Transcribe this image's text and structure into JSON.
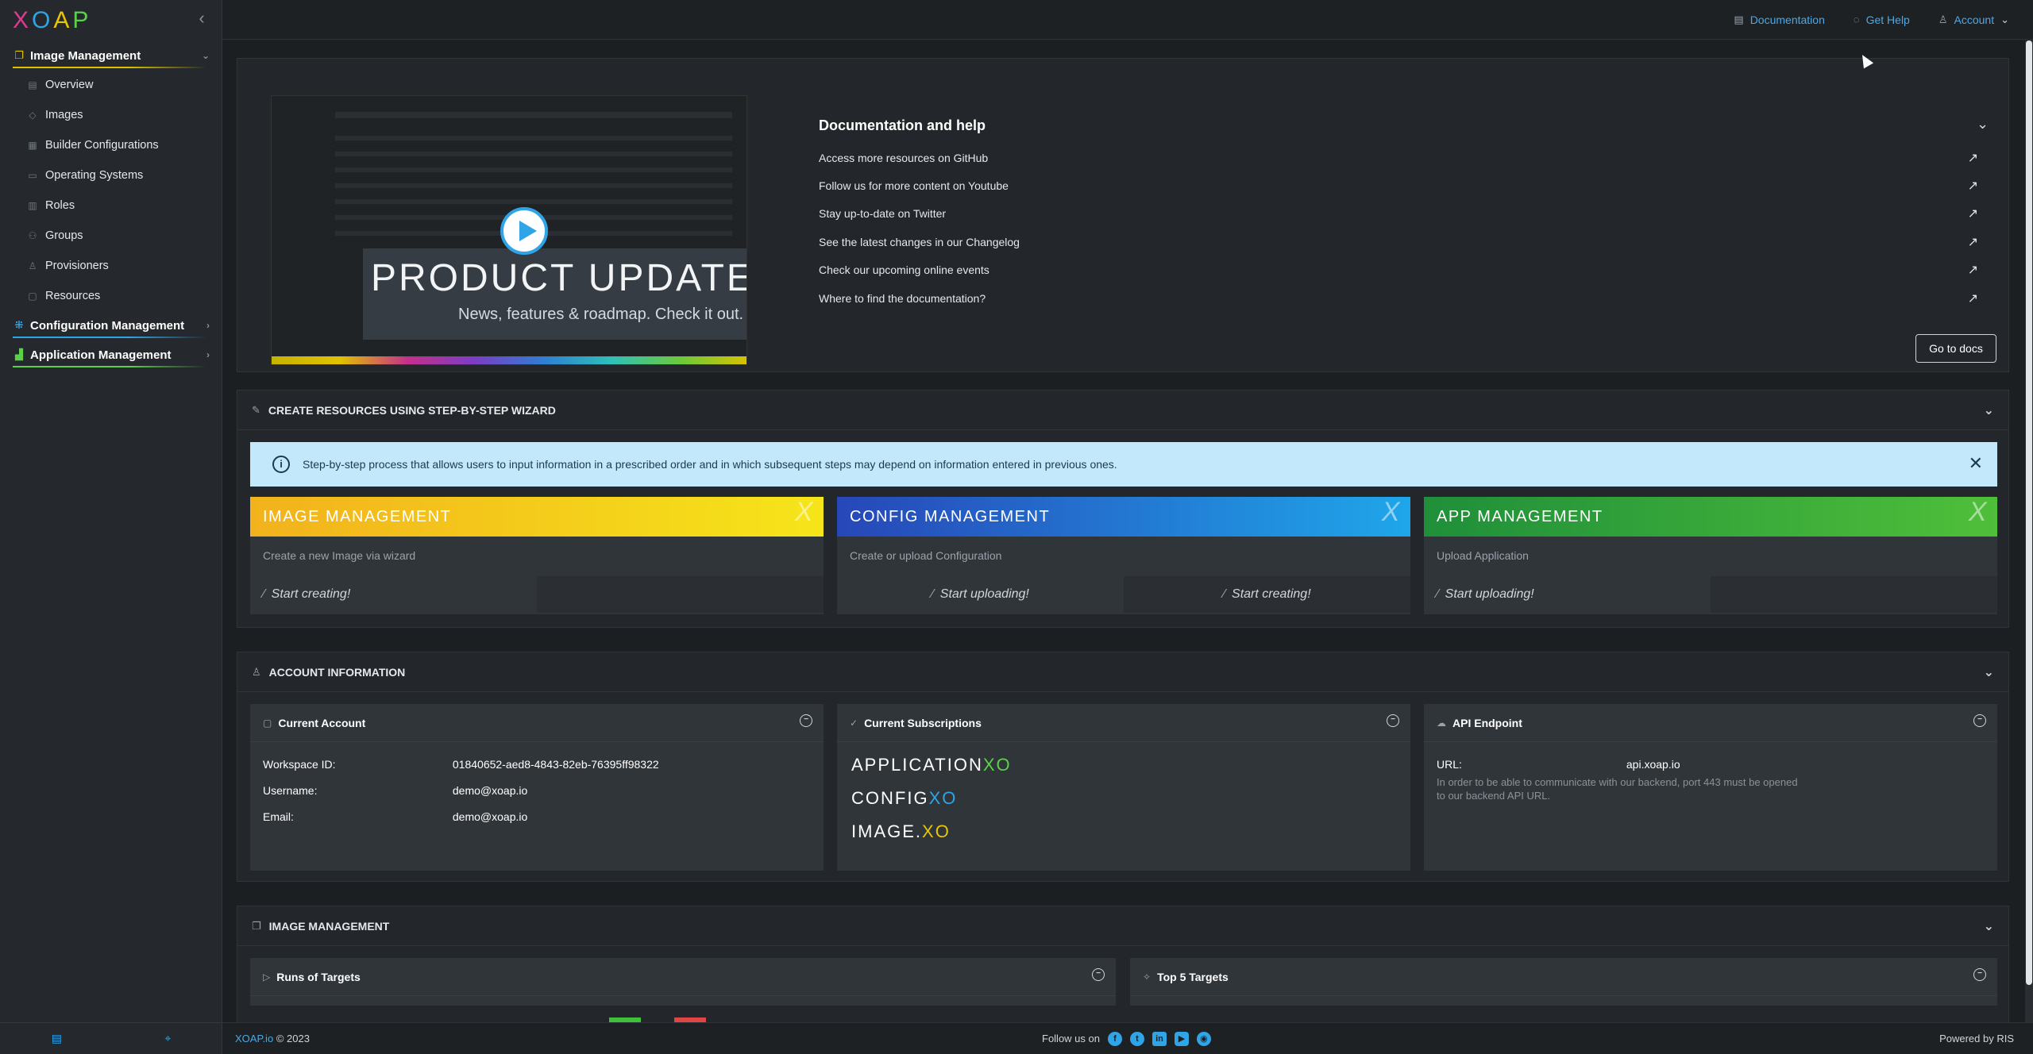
{
  "app": {
    "logo_letters": [
      "X",
      "O",
      "A",
      "P"
    ],
    "logo_colors": [
      "#e03a8e",
      "#2fa4e7",
      "#e8c600",
      "#5bd14a"
    ]
  },
  "sidebar": {
    "groups": [
      {
        "label": "Image Management",
        "icon": "image-stack-icon",
        "expanded": true,
        "underline": "#d9c200"
      },
      {
        "label": "Configuration Management",
        "icon": "config-grid-icon",
        "expanded": false,
        "underline": "#2fa4e7"
      },
      {
        "label": "Application Management",
        "icon": "app-bars-icon",
        "expanded": false,
        "underline": "#5bd14a"
      }
    ],
    "items": [
      {
        "label": "Overview",
        "icon": "overview-icon"
      },
      {
        "label": "Images",
        "icon": "images-icon"
      },
      {
        "label": "Builder Configurations",
        "icon": "builder-icon"
      },
      {
        "label": "Operating Systems",
        "icon": "os-icon"
      },
      {
        "label": "Roles",
        "icon": "roles-icon"
      },
      {
        "label": "Groups",
        "icon": "groups-icon"
      },
      {
        "label": "Provisioners",
        "icon": "provisioners-icon"
      },
      {
        "label": "Resources",
        "icon": "resources-icon"
      }
    ]
  },
  "topbar": {
    "documentation": "Documentation",
    "get_help": "Get Help",
    "account": "Account"
  },
  "doc_help": {
    "video_title": "PRODUCT UPDATES",
    "video_subtitle": "News, features & roadmap. Check it out.",
    "title": "Documentation and help",
    "links": [
      "Access more resources on GitHub",
      "Follow us for more content on Youtube",
      "Stay up-to-date on Twitter",
      "See the latest changes in our Changelog",
      "Check our upcoming online events",
      "Where to find the documentation?"
    ],
    "go_to_docs": "Go to docs"
  },
  "wizard": {
    "title": "CREATE RESOURCES USING STEP-BY-STEP WIZARD",
    "info": "Step-by-step process that allows users to input information in a prescribed order and in which subsequent steps may depend on information entered in previous ones.",
    "cards": [
      {
        "title": "IMAGE MANAGEMENT",
        "desc": "Create a new Image via wizard",
        "actions": [
          "Start creating!"
        ],
        "gradient": [
          "#f2b21c",
          "#f6e51a"
        ]
      },
      {
        "title": "CONFIG MANAGEMENT",
        "desc": "Create or upload Configuration",
        "actions": [
          "Start uploading!",
          "Start creating!"
        ],
        "gradient": [
          "#2747b8",
          "#1fa6ea"
        ]
      },
      {
        "title": "APP MANAGEMENT",
        "desc": "Upload Application",
        "actions": [
          "Start uploading!"
        ],
        "gradient": [
          "#1f8f3a",
          "#4fbf3a"
        ]
      }
    ]
  },
  "account": {
    "title": "ACCOUNT INFORMATION",
    "current_account": {
      "title": "Current Account",
      "workspace_label": "Workspace ID:",
      "workspace_value": "01840652-aed8-4843-82eb-76395ff98322",
      "username_label": "Username:",
      "username_value": "demo@xoap.io",
      "email_label": "Email:",
      "email_value": "demo@xoap.io"
    },
    "subscriptions": {
      "title": "Current Subscriptions",
      "items": [
        {
          "name": "APPLICATION",
          "suffix": "XO",
          "color": "#5bd14a"
        },
        {
          "name": "CONFIG",
          "suffix": "XO",
          "color": "#2fa4e7"
        },
        {
          "name": "IMAGE.",
          "suffix": "XO",
          "color": "#e8c600"
        }
      ]
    },
    "api": {
      "title": "API Endpoint",
      "url_label": "URL:",
      "url_value": "api.xoap.io",
      "note": "In order to be able to communicate with our backend, port 443 must be opened to our backend API URL."
    }
  },
  "image_mgmt": {
    "title": "IMAGE MANAGEMENT",
    "runs_title": "Runs of Targets",
    "top_title": "Top 5 Targets"
  },
  "footer": {
    "brand": "XOAP.io",
    "year": "© 2023",
    "follow": "Follow us on",
    "powered": "Powered by RIS"
  }
}
